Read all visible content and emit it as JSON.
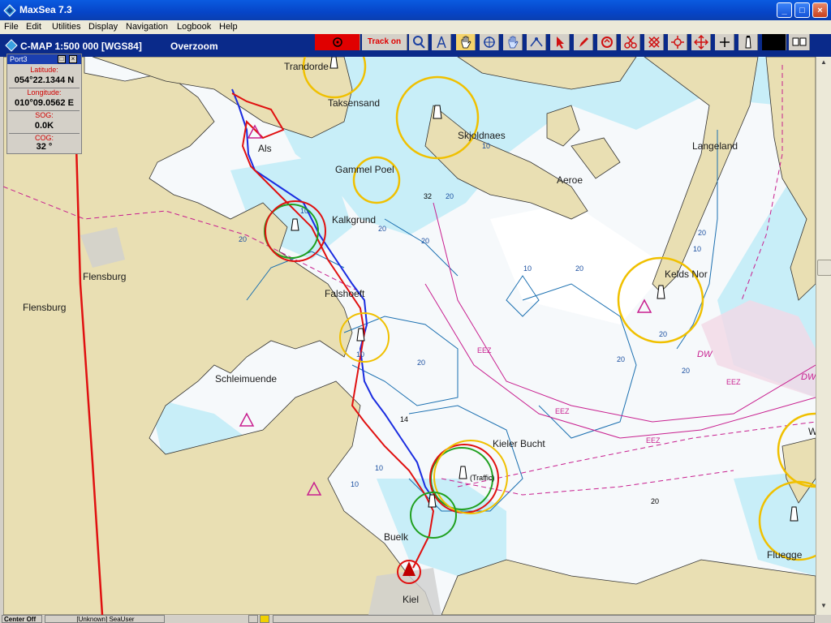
{
  "window": {
    "title": "MaxSea 7.3",
    "buttons": {
      "minimize": "_",
      "maximize": "□",
      "close": "×"
    }
  },
  "menu": [
    "File",
    "Edit",
    "Utilities",
    "Display",
    "Navigation",
    "Logbook",
    "Help"
  ],
  "chart_header": {
    "title": "C-MAP  1:500 000 [WGS84]",
    "mode": "Overzoom"
  },
  "toolbar": {
    "track_label": "Track on",
    "tools": [
      "record-icon",
      "track-toggle",
      "magnifier-icon",
      "compass-icon",
      "hand-pan-icon",
      "crosshair-icon",
      "grab-icon",
      "measure-icon",
      "pointer-icon",
      "pencil-icon",
      "route-icon",
      "scissors-icon",
      "mark-icon",
      "move-icon",
      "cross-icon",
      "lighthouse-icon",
      "black-box",
      "layout-icon"
    ]
  },
  "instrument_panel": {
    "title": "Port3",
    "rows": [
      {
        "label": "Latitude:",
        "value": "054°22.1344 N"
      },
      {
        "label": "Longitude:",
        "value": "010°09.0562 E"
      },
      {
        "label": "SOG:",
        "value": "0.0K"
      },
      {
        "label": "COG:",
        "value": "32 °"
      }
    ]
  },
  "map": {
    "places": {
      "trandborg": "Trandorde",
      "taksensand": "Taksensand",
      "als": "Als",
      "skjoldnaes": "Skjoldnaes",
      "langeland": "Langeland",
      "aeroe": "Aeroe",
      "gammel_poel": "Gammel Poel",
      "kalkgrund": "Kalkgrund",
      "flensburg_town": "Flensburg",
      "flensburg_region": "Flensburg",
      "falshoeft": "Falshoeft",
      "keld_nor": "Kelds Nor",
      "schleimuende": "Schleimuende",
      "kieler_bucht": "Kieler Bucht",
      "traffic": "(Traffic)",
      "buelk": "Buelk",
      "kiel": "Kiel",
      "fluegge": "Fluegge",
      "w_cut": "W"
    },
    "depths": [
      "32",
      "14",
      "20"
    ],
    "contours": [
      "10",
      "20",
      "10",
      "20",
      "10",
      "20",
      "20",
      "20",
      "10",
      "20",
      "10",
      "20",
      "10",
      "20",
      "10",
      "20",
      "20"
    ],
    "zones": {
      "eez": "EEZ",
      "dw": "DW"
    }
  },
  "status": {
    "left": "Center Off",
    "user": "[Unknown] SeaUser"
  }
}
